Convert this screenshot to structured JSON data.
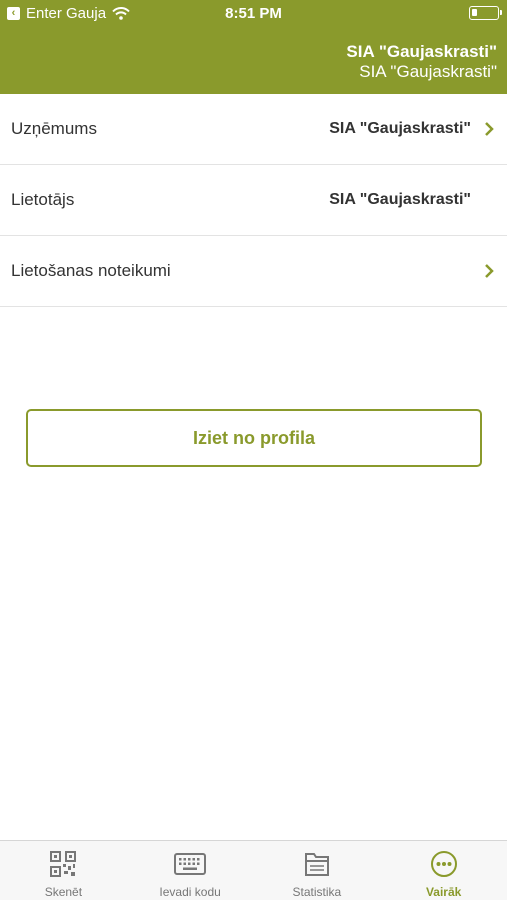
{
  "status_bar": {
    "carrier": "Enter Gauja",
    "time": "8:51 PM"
  },
  "header": {
    "title": "SIA \"Gaujaskrasti\"",
    "subtitle": "SIA \"Gaujaskrasti\""
  },
  "rows": [
    {
      "label": "Uzņēmums",
      "value": "SIA \"Gaujaskrasti\""
    },
    {
      "label": "Lietotājs",
      "value": "SIA \"Gaujaskrasti\""
    },
    {
      "label": "Lietošanas noteikumi",
      "value": ""
    }
  ],
  "logout_label": "Iziet no profila",
  "tabs": [
    {
      "label": "Skenēt",
      "icon": "qr-code-icon"
    },
    {
      "label": "Ievadi kodu",
      "icon": "keyboard-icon"
    },
    {
      "label": "Statistika",
      "icon": "folder-icon"
    },
    {
      "label": "Vairāk",
      "icon": "more-icon"
    }
  ],
  "colors": {
    "accent": "#8a9a2c",
    "tab_inactive": "#777777",
    "background": "#ffffff"
  }
}
